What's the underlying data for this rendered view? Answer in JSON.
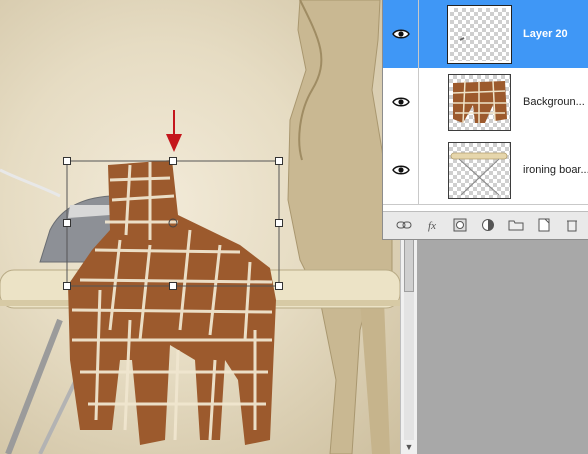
{
  "canvas": {
    "description_free": true
  },
  "layers_panel": {
    "layers": [
      {
        "name": "Layer 20",
        "visible": true,
        "selected": true
      },
      {
        "name": "Backgroun...",
        "visible": true,
        "selected": false
      },
      {
        "name": "ironing boar...",
        "visible": true,
        "selected": false
      }
    ],
    "footer_buttons": [
      {
        "icon": "link-icon"
      },
      {
        "icon": "fx-icon",
        "label": "fx"
      },
      {
        "icon": "mask-icon"
      },
      {
        "icon": "adjustment-icon"
      },
      {
        "icon": "folder-icon"
      },
      {
        "icon": "new-layer-icon"
      },
      {
        "icon": "trash-icon"
      }
    ]
  },
  "colors": {
    "selection_blue": "#3f97f6",
    "arrow_red": "#c4161c"
  }
}
